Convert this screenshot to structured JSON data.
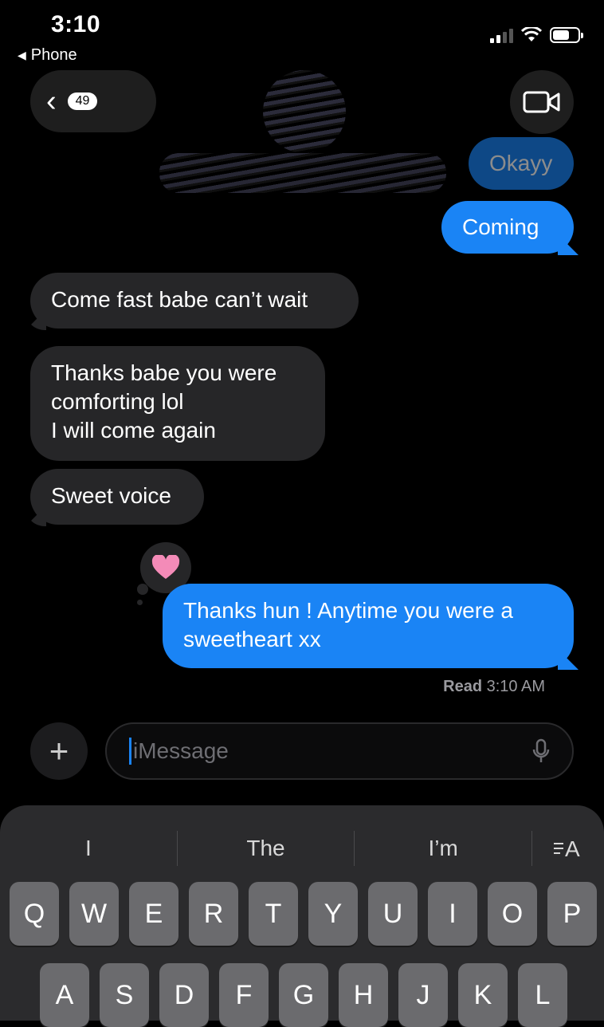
{
  "status_bar": {
    "time": "3:10",
    "back_app": "Phone"
  },
  "nav": {
    "unread_badge": "49"
  },
  "messages": {
    "sent_faded_1": "Okayy",
    "sent_faded_2": "Coming",
    "recv_1": "Come fast babe can’t wait",
    "recv_2_line1": "Thanks babe you were",
    "recv_2_line2": "comforting lol",
    "recv_2_line3": "I will come again",
    "recv_3": "Sweet voice",
    "sent_main_line1": "Thanks hun ! Anytime you were a",
    "sent_main_line2": "sweetheart xx"
  },
  "read_receipt": {
    "label": "Read",
    "time": "3:10 AM"
  },
  "composer": {
    "placeholder": "iMessage"
  },
  "keyboard": {
    "suggestions": [
      "I",
      "The",
      "I’m"
    ],
    "row1": [
      "Q",
      "W",
      "E",
      "R",
      "T",
      "Y",
      "U",
      "I",
      "O",
      "P"
    ],
    "row2": [
      "A",
      "S",
      "D",
      "F",
      "G",
      "H",
      "J",
      "K",
      "L"
    ]
  },
  "colors": {
    "sent_bubble": "#1a84f5",
    "received_bubble": "#262628",
    "background": "#000000"
  }
}
